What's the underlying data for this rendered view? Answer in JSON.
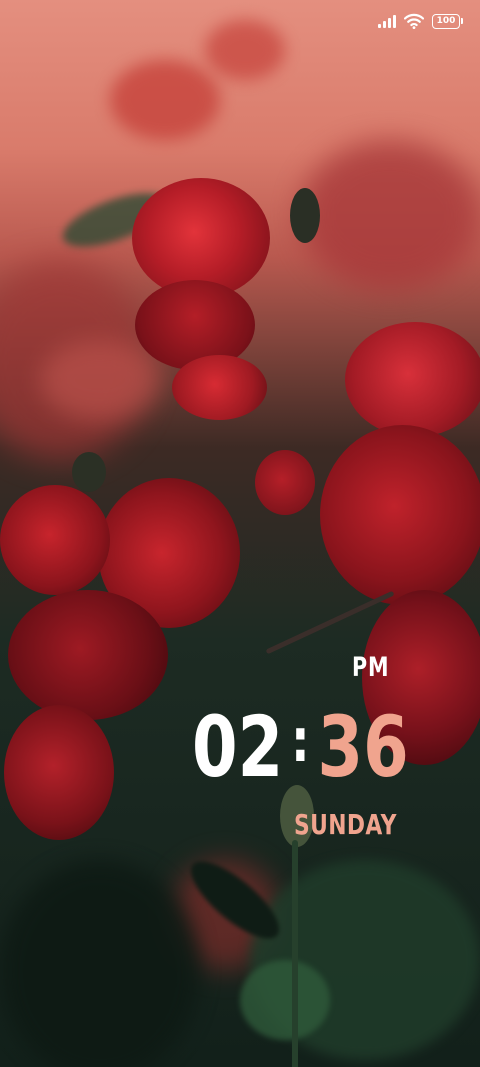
{
  "status_bar": {
    "battery_level": "100",
    "signal_icon": "signal-bars-icon",
    "wifi_icon": "wifi-icon",
    "battery_icon": "battery-icon"
  },
  "lockscreen": {
    "ampm": "PM",
    "hours": "02",
    "separator": ":",
    "minutes": "36",
    "day": "SUNDAY"
  },
  "colors": {
    "hours": "#ffffff",
    "minutes": "#f0a48e",
    "day": "#f0a48e"
  }
}
